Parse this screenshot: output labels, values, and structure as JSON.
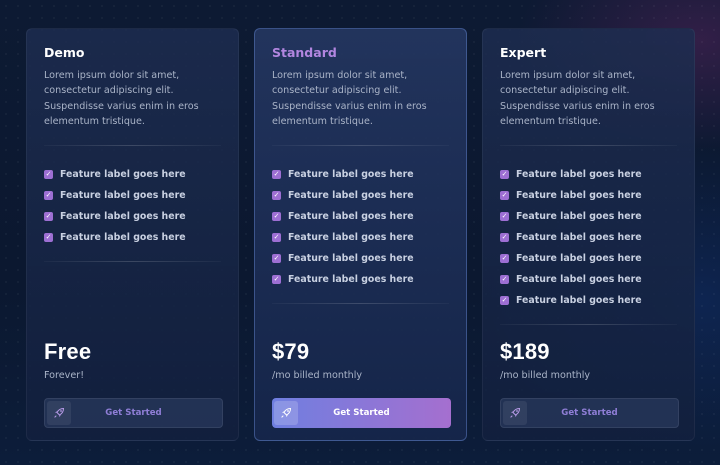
{
  "description": "Lorem ipsum dolor sit amet, consectetur adipiscing elit. Suspendisse varius enim in eros elementum tristique.",
  "feature_label": "Feature label goes here",
  "accent_color": "#b286e0",
  "plans": [
    {
      "name": "Demo",
      "price": "Free",
      "period": "Forever!",
      "cta": "Get Started",
      "cta_icon": "rocket-icon",
      "features": [
        "Feature label goes here",
        "Feature label goes here",
        "Feature label goes here",
        "Feature label goes here"
      ]
    },
    {
      "name": "Standard",
      "price": "$79",
      "period": "/mo billed monthly",
      "cta": "Get Started",
      "cta_icon": "rocket-icon",
      "features": [
        "Feature label goes here",
        "Feature label goes here",
        "Feature label goes here",
        "Feature label goes here",
        "Feature label goes here",
        "Feature label goes here"
      ]
    },
    {
      "name": "Expert",
      "price": "$189",
      "period": "/mo billed monthly",
      "cta": "Get Started",
      "cta_icon": "rocket-icon",
      "features": [
        "Feature label goes here",
        "Feature label goes here",
        "Feature label goes here",
        "Feature label goes here",
        "Feature label goes here",
        "Feature label goes here",
        "Feature label goes here"
      ]
    }
  ]
}
